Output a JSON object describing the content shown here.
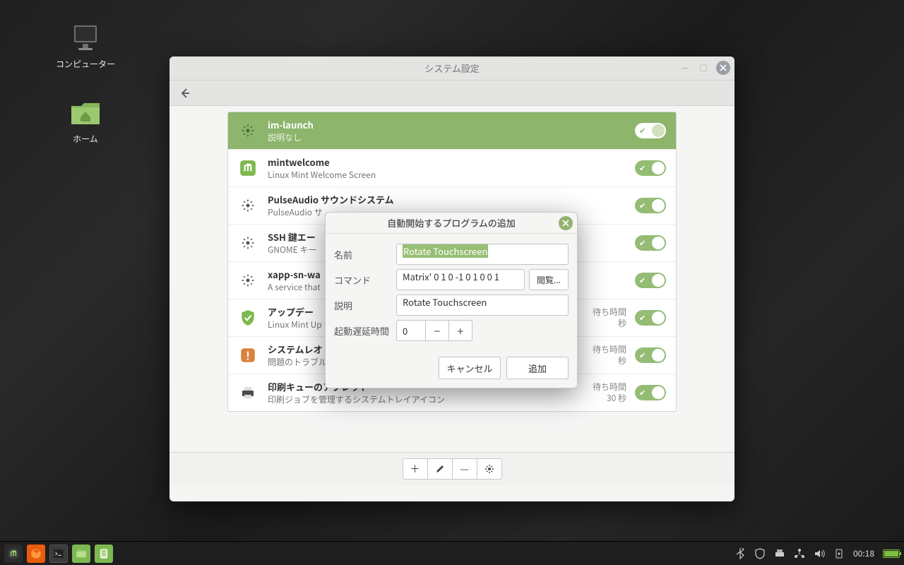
{
  "desktop": {
    "icons": [
      {
        "label": "コンピューター",
        "type": "computer"
      },
      {
        "label": "ホーム",
        "type": "home-folder"
      }
    ]
  },
  "window": {
    "title": "システム設定",
    "items": [
      {
        "title": "im-launch",
        "desc": "説明なし",
        "wait": "",
        "selected": true
      },
      {
        "title": "mintwelcome",
        "desc": "Linux Mint Welcome Screen",
        "wait": ""
      },
      {
        "title": "PulseAudio サウンドシステム",
        "desc": "PulseAudio サ",
        "wait": ""
      },
      {
        "title": "SSH 鍵エー",
        "desc": "GNOME キー",
        "wait": ""
      },
      {
        "title": "xapp-sn-wa",
        "desc": "A service that",
        "wait": ""
      },
      {
        "title": "アップデー",
        "desc": "Linux Mint Up",
        "wait": "待ち時間\n秒"
      },
      {
        "title": "システムレオ",
        "desc": "問題のトラブル",
        "wait": "待ち時間\n秒"
      },
      {
        "title": "印刷キューのアプレット",
        "desc": "印刷ジョブを管理するシステムトレイアイコン",
        "wait": "待ち時間\n30 秒"
      }
    ]
  },
  "dialog": {
    "title": "自動開始するプログラムの追加",
    "labels": {
      "name": "名前",
      "command": "コマンド",
      "desc": "説明",
      "delay": "起動遅延時間"
    },
    "name_value": "Rotate Touchscreen",
    "command_value": "Matrix' 0 1 0 -1 0 1 0 0 1",
    "desc_value": "Rotate Touchscreen",
    "delay_value": "0",
    "browse": "閲覧...",
    "cancel": "キャンセル",
    "add": "追加"
  },
  "panel": {
    "clock": "00:18"
  }
}
